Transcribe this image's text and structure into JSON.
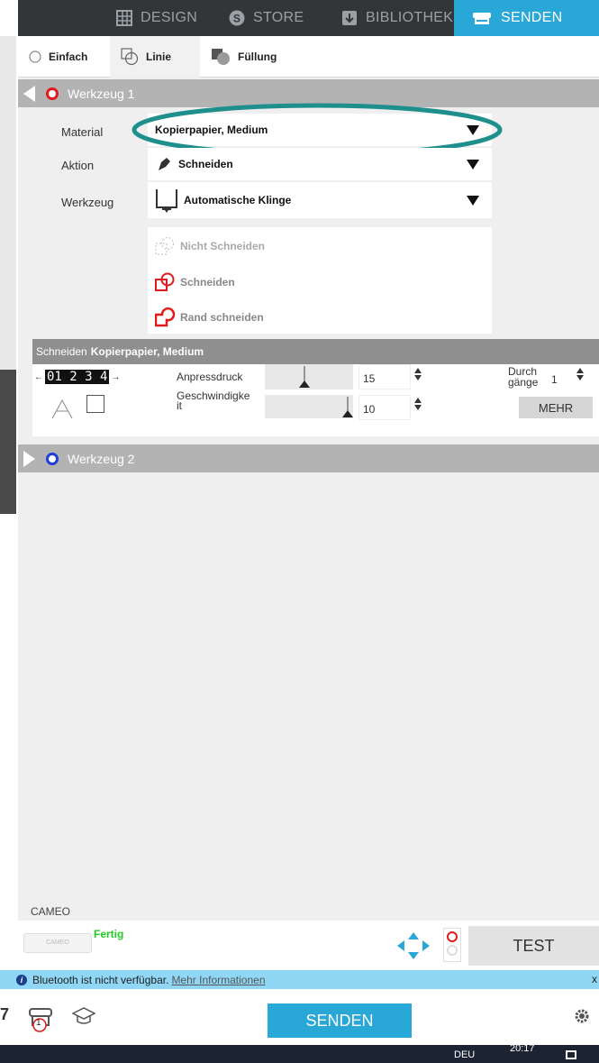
{
  "nav": {
    "tabs": [
      {
        "label": "DESIGN",
        "icon": "grid-icon"
      },
      {
        "label": "STORE",
        "icon": "store-s-icon"
      },
      {
        "label": "BIBLIOTHEK",
        "icon": "library-download-icon"
      },
      {
        "label": "SENDEN",
        "icon": "cutter-send-icon",
        "active": true
      }
    ]
  },
  "modes": [
    {
      "label": "Einfach",
      "icon": "radio-icon"
    },
    {
      "label": "Linie",
      "icon": "line-mode-icon",
      "active": true
    },
    {
      "label": "Füllung",
      "icon": "fill-mode-icon"
    }
  ],
  "tool1": {
    "title": "Werkzeug 1",
    "color": "#e11b1b",
    "labels": {
      "material": "Material",
      "action": "Aktion",
      "tool": "Werkzeug"
    },
    "material_value": "Kopierpapier, Medium",
    "action_value": "Schneiden",
    "tool_value": "Automatische Klinge",
    "cut_options": [
      "Nicht Schneiden",
      "Schneiden",
      "Rand schneiden"
    ]
  },
  "settings": {
    "prefix": "Schneiden",
    "material": "Kopierpapier, Medium",
    "blade_digits": "01 2 3 4",
    "pressure_label": "Anpressdruck",
    "pressure_value": "15",
    "speed_label": "Geschwindigke it",
    "speed_value": "10",
    "passes_label": "Durch gänge",
    "passes_value": "1",
    "more_label": "MEHR"
  },
  "tool2": {
    "title": "Werkzeug 2",
    "color": "#1f3fd8"
  },
  "machine": {
    "section_label": "CAMEO",
    "status": "Fertig",
    "device_label": "CAMEO",
    "test_label": "TEST"
  },
  "bluetooth": {
    "message": "Bluetooth ist nicht verfügbar.",
    "link": "Mehr Informationen",
    "close": "x"
  },
  "bottom": {
    "send_label": "SENDEN",
    "queue_count": "1"
  },
  "taskbar": {
    "lang": "DEU",
    "time": "20:17"
  },
  "colors": {
    "accent": "#29a8d8",
    "highlight_ellipse": "#1e8f8c",
    "status_ok": "#22cc22"
  }
}
